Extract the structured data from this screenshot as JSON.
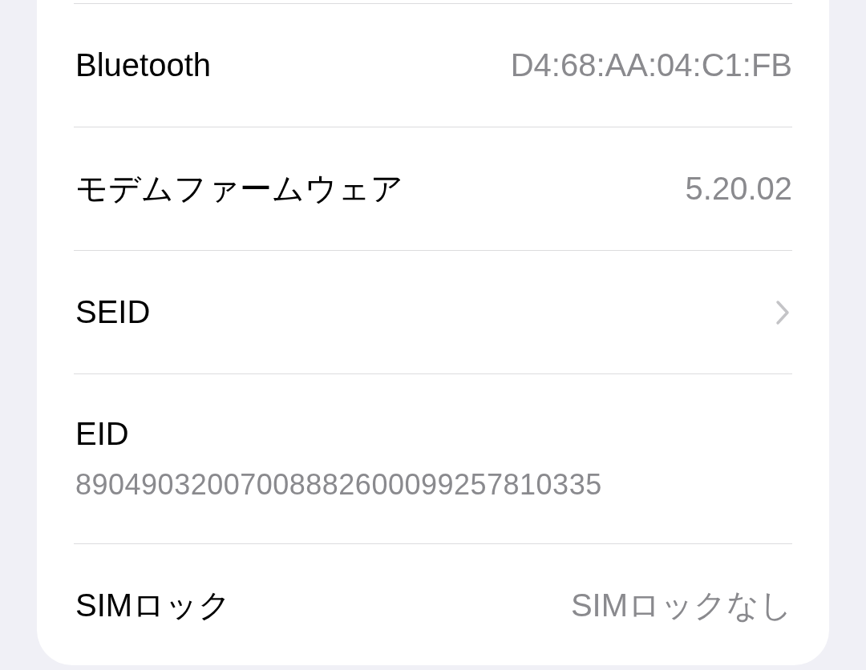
{
  "rows": [
    {
      "kind": "value",
      "label": "Bluetooth",
      "value": "D4:68:AA:04:C1:FB"
    },
    {
      "kind": "value",
      "label": "モデムファームウェア",
      "value": "5.20.02"
    },
    {
      "kind": "chevron",
      "label": "SEID"
    },
    {
      "kind": "stacked",
      "label": "EID",
      "value": "89049032007008882600099257810335"
    },
    {
      "kind": "value",
      "label": "SIMロック",
      "value": "SIMロックなし"
    }
  ]
}
